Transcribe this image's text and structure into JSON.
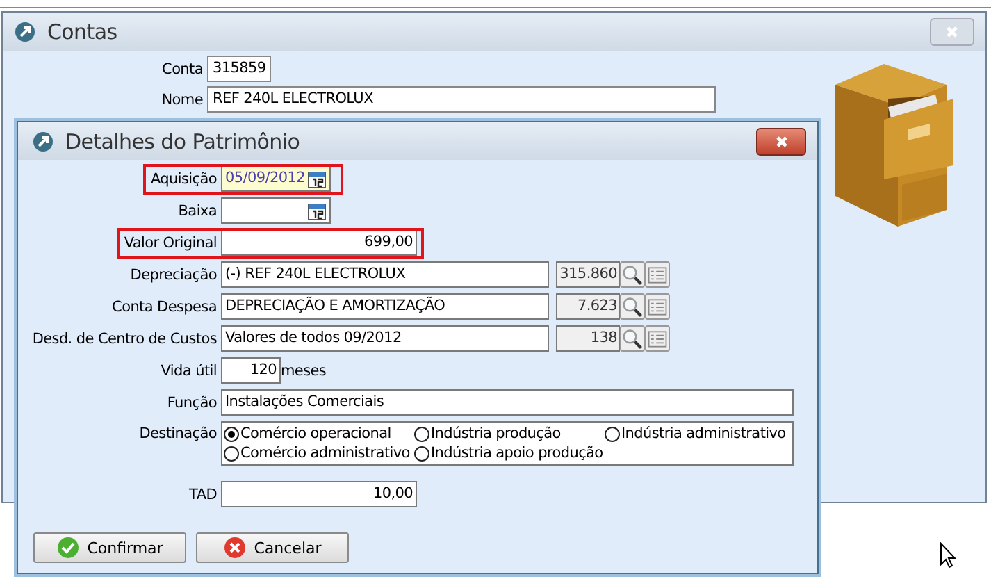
{
  "background_window": {
    "title": "Contas",
    "fields": [
      {
        "label": "Conta",
        "value": "315859",
        "kind": "short"
      },
      {
        "label": "Nome",
        "value": "REF 240L ELECTROLUX",
        "kind": "long"
      }
    ]
  },
  "dialog": {
    "title": "Detalhes do Patrimônio",
    "fields": [
      {
        "kind": "date",
        "label": "Aquisição",
        "value": "05/09/2012",
        "focused": true,
        "highlighted": true
      },
      {
        "kind": "date",
        "label": "Baixa",
        "focused": false,
        "highlighted": false
      },
      {
        "kind": "amount",
        "label": "Valor Original",
        "value": "699,00",
        "highlighted": true
      },
      {
        "kind": "lookup",
        "label": "Depreciação",
        "value": "(-) REF 240L ELECTROLUX",
        "code": "315.860",
        "highlighted": false
      },
      {
        "kind": "lookup",
        "label": "Conta Despesa",
        "value": "DEPRECIAÇÃO E AMORTIZAÇÃO",
        "code": "7.623",
        "highlighted": false
      },
      {
        "kind": "lookup",
        "label": "Desd. de Centro de Custos",
        "value": "Valores de todos 09/2012",
        "code": "138",
        "highlighted": false
      },
      {
        "kind": "unit",
        "label": "Vida útil",
        "value": "120",
        "unit": "meses",
        "highlighted": false
      },
      {
        "kind": "text",
        "label": "Função",
        "value": "Instalações Comerciais",
        "highlighted": false
      },
      {
        "kind": "radio",
        "label": "Destinação",
        "highlighted": false,
        "options": [
          {
            "label": "Comércio operacional",
            "selected": true
          },
          {
            "label": "Indústria produção",
            "selected": false
          },
          {
            "label": "Indústria administrativo",
            "selected": false
          },
          {
            "label": "Comércio administrativo",
            "selected": false
          },
          {
            "label": "Indústria apoio produção",
            "selected": false
          }
        ]
      },
      {
        "kind": "amount",
        "label": "TAD",
        "value": "10,00",
        "highlighted": false
      }
    ],
    "buttons": [
      {
        "kind": "confirm",
        "label": "Confirmar"
      },
      {
        "kind": "cancel",
        "label": "Cancelar"
      }
    ]
  }
}
